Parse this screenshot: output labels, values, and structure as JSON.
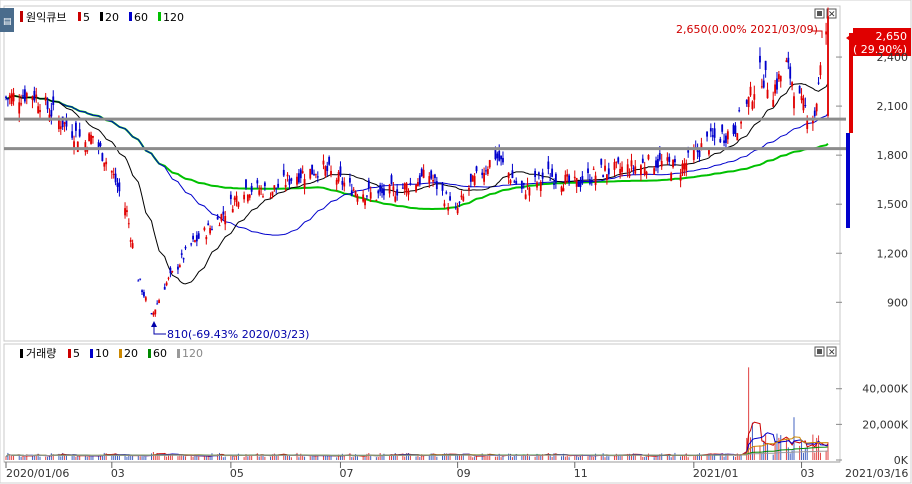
{
  "price_panel": {
    "legend": {
      "marker_color": "#c00000",
      "title": "원익큐브",
      "items": [
        {
          "label": "5",
          "color": "#cc0000"
        },
        {
          "label": "20",
          "color": "#000000"
        },
        {
          "label": "60",
          "color": "#0000cc"
        },
        {
          "label": "120",
          "color": "#00c000"
        }
      ]
    },
    "y_ticks": [
      "2,400",
      "2,100",
      "1,800",
      "1,500",
      "1,200",
      "900"
    ],
    "y_tick_values": [
      2400,
      2100,
      1800,
      1500,
      1200,
      900
    ],
    "y_range": [
      700,
      2700
    ],
    "current_price_box": {
      "price": "2,650",
      "change": "( 29.90%)",
      "color": "#e00000"
    },
    "high_annotation": "2,650(0.00% 2021/03/09)",
    "low_annotation": "810(-69.43% 2020/03/23)",
    "horizontal_lines": [
      2020,
      1840
    ]
  },
  "volume_panel": {
    "legend": {
      "title": "거래량",
      "items": [
        {
          "label": "5",
          "color": "#cc0000"
        },
        {
          "label": "10",
          "color": "#0000cc"
        },
        {
          "label": "20",
          "color": "#cc8800"
        },
        {
          "label": "60",
          "color": "#008800"
        },
        {
          "label": "120",
          "color": "#999999"
        }
      ]
    },
    "y_ticks": [
      "40,000K",
      "20,000K",
      "0K"
    ],
    "y_tick_values": [
      40000,
      20000,
      0
    ],
    "y_range": [
      0,
      55000
    ]
  },
  "x_axis": {
    "labels": [
      "2020/01/06",
      "03",
      "05",
      "07",
      "09",
      "11",
      "2021/01",
      "03"
    ],
    "last_date": "2021/03/16"
  },
  "chart_data": {
    "type": "candlestick",
    "x_start": "2020/01/06",
    "x_end": "2021/03/16",
    "series": [
      {
        "name": "원익큐브",
        "date_points": [
          {
            "x": "2020/01/06",
            "close": 2150
          },
          {
            "x": "2020/01/20",
            "close": 2180
          },
          {
            "x": "2020/02/03",
            "close": 2020
          },
          {
            "x": "2020/02/17",
            "close": 1880
          },
          {
            "x": "2020/02/21",
            "close": 1920
          },
          {
            "x": "2020/03/02",
            "close": 1700
          },
          {
            "x": "2020/03/10",
            "close": 1450
          },
          {
            "x": "2020/03/16",
            "close": 1050
          },
          {
            "x": "2020/03/23",
            "close": 810
          },
          {
            "x": "2020/03/30",
            "close": 1000
          },
          {
            "x": "2020/04/13",
            "close": 1250
          },
          {
            "x": "2020/04/27",
            "close": 1400
          },
          {
            "x": "2020/05/11",
            "close": 1600
          },
          {
            "x": "2020/05/25",
            "close": 1580
          },
          {
            "x": "2020/06/08",
            "close": 1680
          },
          {
            "x": "2020/06/22",
            "close": 1720
          },
          {
            "x": "2020/07/06",
            "close": 1600
          },
          {
            "x": "2020/07/20",
            "close": 1550
          },
          {
            "x": "2020/08/03",
            "close": 1600
          },
          {
            "x": "2020/08/17",
            "close": 1680
          },
          {
            "x": "2020/08/31",
            "close": 1450
          },
          {
            "x": "2020/09/07",
            "close": 1600
          },
          {
            "x": "2020/09/21",
            "close": 1800
          },
          {
            "x": "2020/10/05",
            "close": 1580
          },
          {
            "x": "2020/10/19",
            "close": 1680
          },
          {
            "x": "2020/11/02",
            "close": 1620
          },
          {
            "x": "2020/11/16",
            "close": 1700
          },
          {
            "x": "2020/11/30",
            "close": 1720
          },
          {
            "x": "2020/12/14",
            "close": 1760
          },
          {
            "x": "2020/12/28",
            "close": 1720
          },
          {
            "x": "2021/01/11",
            "close": 1880
          },
          {
            "x": "2021/01/25",
            "close": 1950
          },
          {
            "x": "2021/02/01",
            "close": 2100
          },
          {
            "x": "2021/02/08",
            "close": 2300
          },
          {
            "x": "2021/02/15",
            "close": 2200
          },
          {
            "x": "2021/02/22",
            "close": 2350
          },
          {
            "x": "2021/03/02",
            "close": 2100
          },
          {
            "x": "2021/03/09",
            "close": 2050
          },
          {
            "x": "2021/03/16",
            "close": 2650
          }
        ]
      }
    ],
    "annotations": [
      "2,650(0.00% 2021/03/09)",
      "810(-69.43% 2020/03/23)"
    ],
    "ylim": [
      700,
      2700
    ],
    "grid": false,
    "legend": "top-left"
  }
}
